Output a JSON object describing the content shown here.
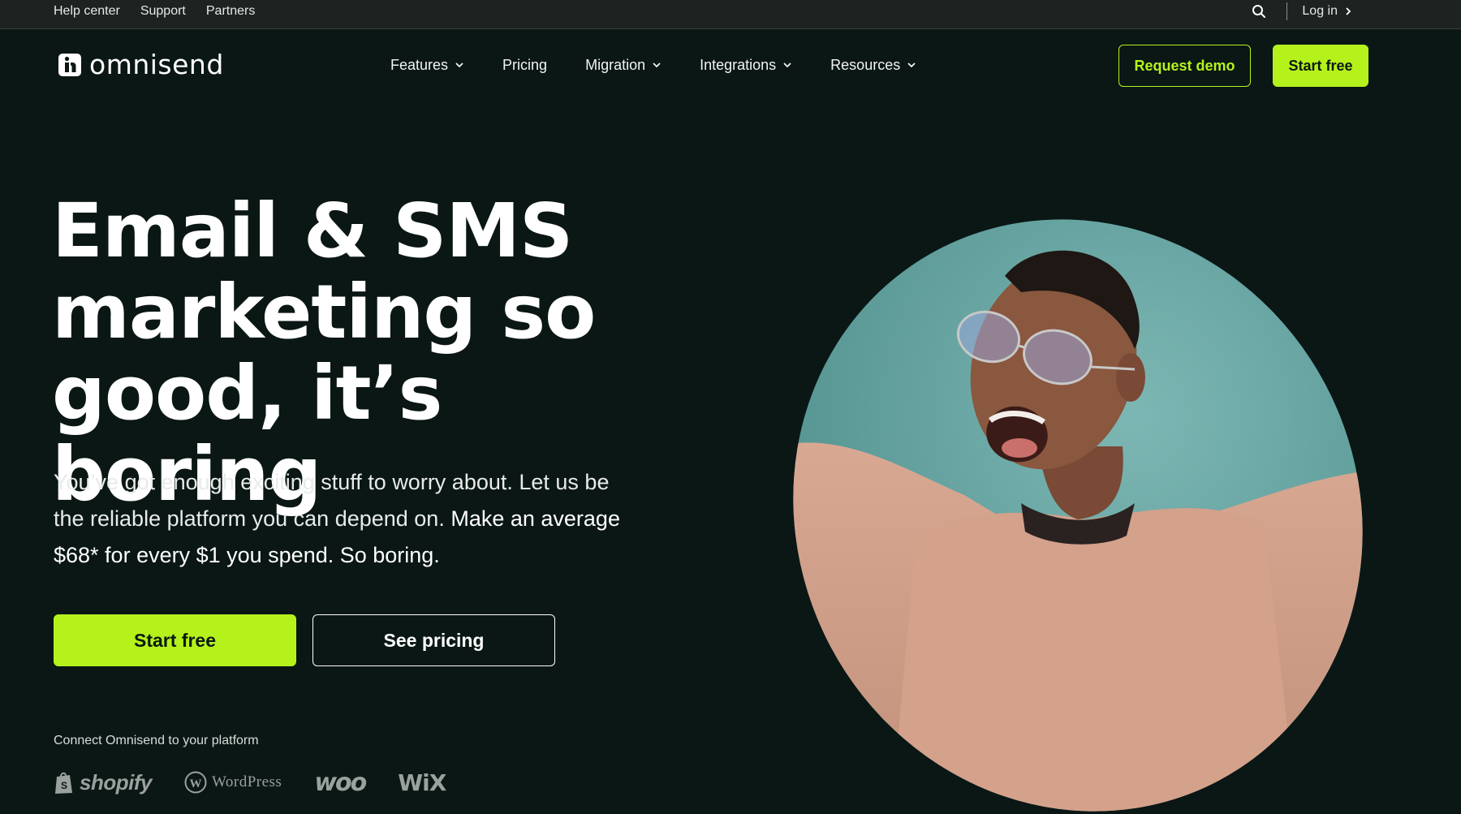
{
  "utility_bar": {
    "links": [
      "Help center",
      "Support",
      "Partners"
    ],
    "login_label": "Log in"
  },
  "brand": {
    "logo_text": "omnisend"
  },
  "nav": {
    "items": [
      {
        "label": "Features",
        "has_dropdown": true
      },
      {
        "label": "Pricing",
        "has_dropdown": false
      },
      {
        "label": "Migration",
        "has_dropdown": true
      },
      {
        "label": "Integrations",
        "has_dropdown": true
      },
      {
        "label": "Resources",
        "has_dropdown": true
      }
    ],
    "request_demo_label": "Request demo",
    "start_free_label": "Start free"
  },
  "hero": {
    "title_lines": [
      "Email & SMS",
      "marketing so",
      "good, it’s boring"
    ],
    "subtitle_plain": "You’ve got enough exciting stuff to worry about. Let us be the reliable platform you can depend on. ",
    "subtitle_emphasis": "Make an average $68* for every $1 you spend. So boring.",
    "primary_cta": "Start free",
    "secondary_cta": "See pricing",
    "connect_label": "Connect Omnisend to your platform",
    "platforms": [
      "shopify",
      "WordPress",
      "woo",
      "WiX"
    ]
  },
  "colors": {
    "background": "#0a1715",
    "accent": "#b5f21c",
    "utility_bar": "#1d2321",
    "image_backdrop": "#5f9f9d"
  },
  "icons": [
    "search-icon",
    "chevron-right-icon",
    "chevron-down-icon",
    "omnisend-logo-icon",
    "shopify-bag-icon",
    "wordpress-icon"
  ]
}
